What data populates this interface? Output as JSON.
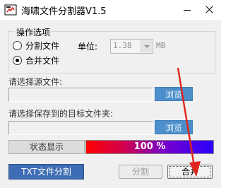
{
  "window": {
    "title": "海啸文件分割器V1.5",
    "icon": "app-icon"
  },
  "options": {
    "group_title": "操作选项",
    "split_label": "分割文件",
    "merge_label": "合并文件",
    "selected": "merge",
    "unit_label": "单位:",
    "unit_value": "1.38",
    "unit_suffix": "MB"
  },
  "source": {
    "label": "请选择源文件:",
    "value": "",
    "browse_label": "浏览"
  },
  "target": {
    "label": "请选择保存到的目标文件夹:",
    "value": "",
    "browse_label": "浏览"
  },
  "status": {
    "label": "状态显示",
    "progress_percent": 100,
    "progress_text": "100 %"
  },
  "buttons": {
    "txt_split": "TXT文件分割",
    "split": "分割",
    "merge": "合并"
  },
  "colors": {
    "browse_button": "#4c8fca",
    "txt_button": "#3f6db5",
    "annotation_arrow": "#e0241b"
  }
}
